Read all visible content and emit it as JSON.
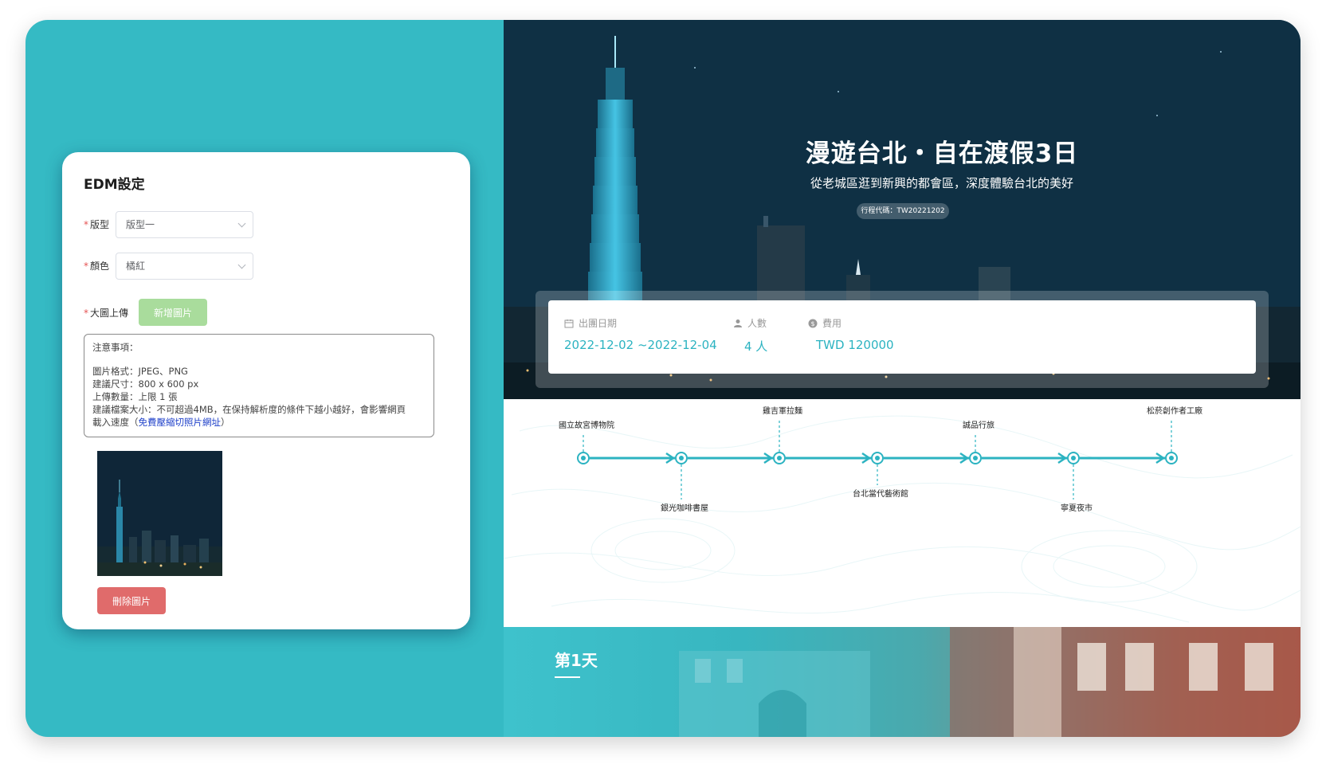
{
  "settings": {
    "title": "EDM設定",
    "layout_label": "版型",
    "layout_value": "版型一",
    "color_label": "顏色",
    "color_value": "橘紅",
    "upload_label": "大圖上傳",
    "add_image_label": "新增圖片",
    "delete_image_label": "刪除圖片",
    "notice": {
      "title": "注意事項：",
      "format": "圖片格式：JPEG、PNG",
      "size": "建議尺寸：800 x 600 px",
      "count": "上傳數量：上限 1 張",
      "filesize": "建議檔案大小：不可超過4MB，在保持解析度的條件下越小越好，會影響網頁",
      "speed_prefix": "載入速度（",
      "link": "免費壓縮切照片網址",
      "speed_suffix": "）"
    }
  },
  "preview": {
    "title": "漫遊台北・自在渡假3日",
    "subtitle": "從老城區逛到新興的都會區，深度體驗台北的美好",
    "code": "行程代碼：TW20221202",
    "info": [
      {
        "label": "出團日期",
        "value": "2022-12-02 ~2022-12-04",
        "icon": "calendar-icon"
      },
      {
        "label": "人數",
        "value": "4 人",
        "icon": "person-icon"
      },
      {
        "label": "費用",
        "value": "TWD 120000",
        "icon": "dollar-icon"
      }
    ],
    "route_stops": [
      {
        "name": "國立故宮博物院",
        "position": "top"
      },
      {
        "name": "銀光咖啡書屋",
        "position": "bottom"
      },
      {
        "name": "雞吉軍拉麵",
        "position": "top"
      },
      {
        "name": "台北當代藝術館",
        "position": "bottom"
      },
      {
        "name": "誠品行旅",
        "position": "top"
      },
      {
        "name": "寧夏夜市",
        "position": "bottom"
      },
      {
        "name": "松菸創作者工廠",
        "position": "top"
      }
    ],
    "day_title": "第1天"
  },
  "colors": {
    "brand_teal": "#35bac4",
    "accent_teal": "#2cb3c1",
    "delete_red": "#e06b6b",
    "add_green": "#a9dc9c"
  }
}
